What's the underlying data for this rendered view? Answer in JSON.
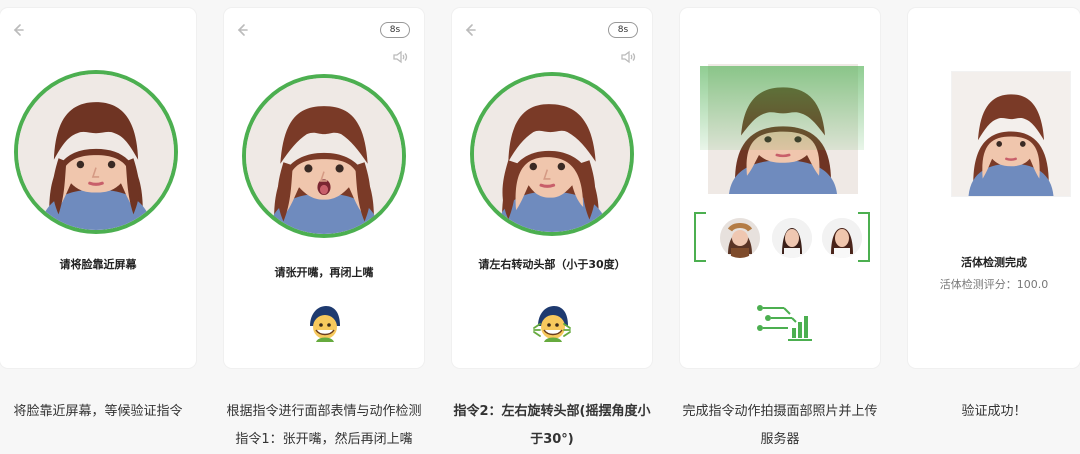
{
  "cards": [
    {
      "instruction": "请将脸靠近屏幕",
      "caption": [
        "将脸靠近屏幕，等候验证指令"
      ]
    },
    {
      "timer": "8s",
      "instruction": "请张开嘴，再闭上嘴",
      "caption": [
        "根据指令进行面部表情与动作检测",
        "指令1：张开嘴，然后再闭上嘴"
      ]
    },
    {
      "timer": "8s",
      "instruction": "请左右转动头部（小于30度）",
      "caption": [
        "指令2：左右旋转头部(摇摆角度小",
        "于30°)"
      ]
    },
    {
      "caption": [
        "完成指令动作拍摄面部照片并上传",
        "服务器"
      ]
    },
    {
      "status": "活体检测完成",
      "score_text": "活体检测评分：100.0",
      "caption": [
        "验证成功！"
      ]
    }
  ],
  "colors": {
    "accent": "#4caf50",
    "text": "#222222",
    "muted": "#777777"
  },
  "icons": {
    "back": "arrow-left",
    "sound": "speaker",
    "mascot": "face-mascot",
    "upload": "circuit-upload"
  }
}
